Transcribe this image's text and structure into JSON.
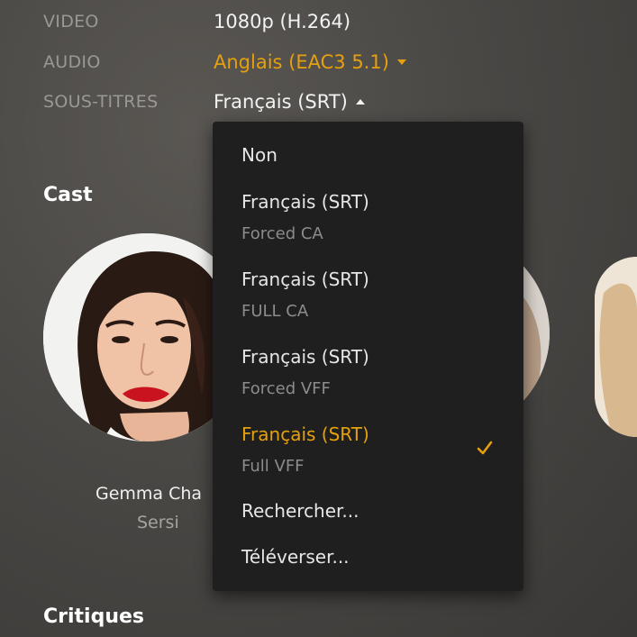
{
  "media_info": {
    "video": {
      "label": "VIDEO",
      "value": "1080p (H.264)"
    },
    "audio": {
      "label": "AUDIO",
      "value": "Anglais (EAC3 5.1)"
    },
    "subtitles": {
      "label": "SOUS-TITRES",
      "value": "Français (SRT)"
    }
  },
  "cast": {
    "title": "Cast",
    "members": [
      {
        "name": "Gemma Cha",
        "role": "Sersi"
      }
    ]
  },
  "reviews": {
    "title": "Critiques"
  },
  "subtitle_menu": {
    "items": [
      {
        "label": "Non",
        "sub": ""
      },
      {
        "label": "Français (SRT)",
        "sub": "Forced CA"
      },
      {
        "label": "Français (SRT)",
        "sub": "FULL CA"
      },
      {
        "label": "Français (SRT)",
        "sub": "Forced VFF"
      },
      {
        "label": "Français (SRT)",
        "sub": "Full VFF",
        "selected": true
      },
      {
        "label": "Rechercher...",
        "sub": ""
      },
      {
        "label": "Téléverser...",
        "sub": ""
      }
    ]
  },
  "colors": {
    "accent": "#e5a00d",
    "menu_bg": "#1f1f1f"
  },
  "icons": {
    "dropdown": "caret-down-icon",
    "dropup": "caret-up-icon",
    "selected": "checkmark-icon"
  }
}
